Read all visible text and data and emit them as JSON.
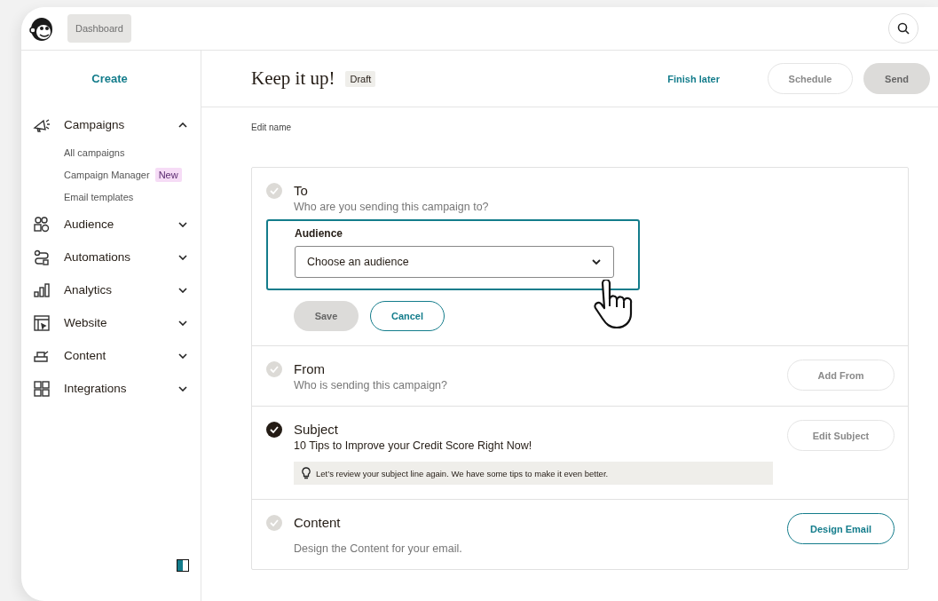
{
  "topbar": {
    "tooltip": "Dashboard"
  },
  "sidebar": {
    "create": "Create",
    "items": [
      {
        "label": "Campaigns",
        "expanded": true,
        "children": [
          {
            "label": "All campaigns"
          },
          {
            "label": "Campaign Manager",
            "badge": "New"
          },
          {
            "label": "Email templates"
          }
        ]
      },
      {
        "label": "Audience",
        "expanded": false
      },
      {
        "label": "Automations",
        "expanded": false
      },
      {
        "label": "Analytics",
        "expanded": false
      },
      {
        "label": "Website",
        "expanded": false
      },
      {
        "label": "Content",
        "expanded": false
      },
      {
        "label": "Integrations",
        "expanded": false
      }
    ]
  },
  "header": {
    "title": "Keep it up!",
    "status": "Draft",
    "finish_later": "Finish later",
    "buttons": [
      {
        "label": "Schedule",
        "kind": "outline",
        "disabled": true
      },
      {
        "label": "Send",
        "kind": "filled",
        "disabled": true
      }
    ]
  },
  "edit_name": "Edit name",
  "sections": [
    {
      "kind": "form",
      "title": "To",
      "subtitle": "Who are you sending this campaign to?",
      "complete": false,
      "field_label": "Audience",
      "field_value": "Choose an audience",
      "buttons": [
        {
          "label": "Save",
          "kind": "filled",
          "disabled": true
        },
        {
          "label": "Cancel",
          "kind": "outline",
          "disabled": false
        }
      ]
    },
    {
      "kind": "row",
      "title": "From",
      "subtitle": "Who is sending this campaign?",
      "complete": false,
      "action": {
        "label": "Add From",
        "disabled": true
      }
    },
    {
      "kind": "row",
      "title": "Subject",
      "subtitle": "10 Tips to Improve your Credit Score Right Now!",
      "complete": true,
      "tip": "Let’s review your subject line again. We have some tips to make it even better.",
      "action": {
        "label": "Edit Subject",
        "disabled": true
      }
    },
    {
      "kind": "row",
      "title": "Content",
      "subtitle": "Design the Content for your email.",
      "complete": false,
      "action": {
        "label": "Design Email",
        "disabled": false
      }
    }
  ]
}
